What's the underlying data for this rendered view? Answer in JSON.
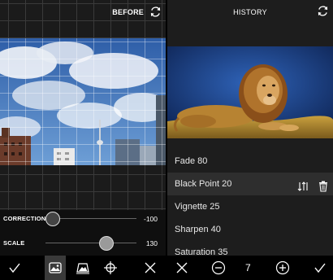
{
  "left_panel": {
    "before_label": "BEFORE",
    "controls": {
      "correction": {
        "label": "CORRECTION",
        "value": "-100",
        "level": 0.08
      },
      "scale": {
        "label": "SCALE",
        "value": "130",
        "level": 0.72
      }
    },
    "toolbar": {
      "items": [
        "checkmark-icon",
        "rotate-image-icon",
        "perspective-icon",
        "crop-move-icon",
        "close-icon"
      ],
      "active": "rotate-image-icon"
    }
  },
  "right_panel": {
    "title": "HISTORY",
    "history": [
      {
        "label": "Fade 80"
      },
      {
        "label": "Black Point 20",
        "selected": true
      },
      {
        "label": "Vignette 25"
      },
      {
        "label": "Sharpen 40"
      },
      {
        "label": "Saturation 35"
      }
    ],
    "toolbar": {
      "step_count": "7"
    }
  },
  "colors": {
    "panel_bg": "#1b1b1b",
    "toolbar_bg": "#000000",
    "selected_row": "#2e2e2e",
    "sky_blue": "#1a3a73"
  }
}
